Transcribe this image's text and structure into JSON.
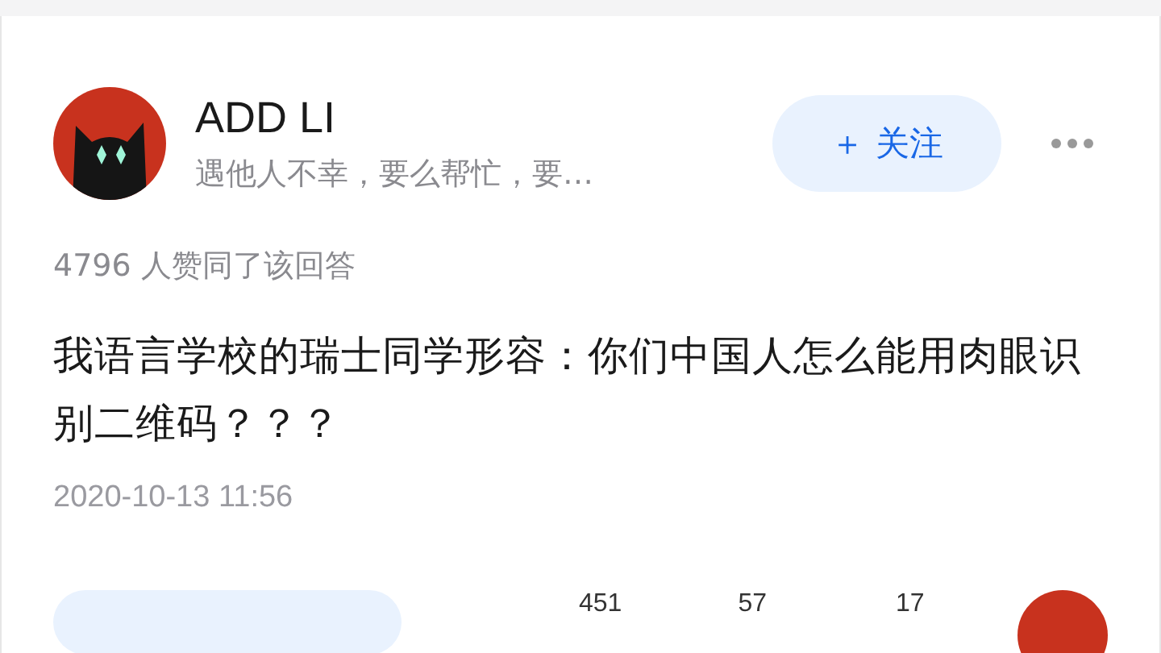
{
  "author": {
    "name": "ADD LI",
    "bio": "遇他人不幸，要么帮忙，要…",
    "follow_button": "＋ 关注"
  },
  "upvote_line": "4796 人赞同了该回答",
  "content": "我语言学校的瑞士同学形容：你们中国人怎么能用肉眼识别二维码？？？",
  "date": "2020-10-13 11:56",
  "counts": [
    "451",
    "57",
    "17"
  ]
}
